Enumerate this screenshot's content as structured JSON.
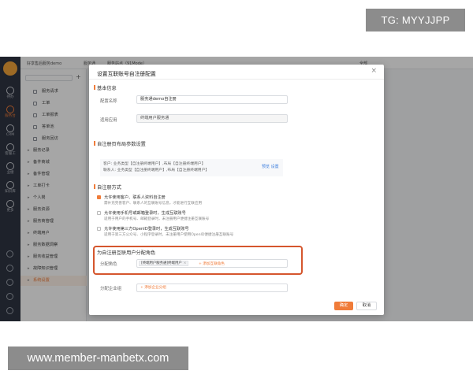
{
  "watermark_top": "TG: MYYJJPP",
  "watermark_bottom": "www.member-manbetx.com",
  "rail": {
    "items": [
      {
        "label": "待办"
      },
      {
        "label": "服务台"
      },
      {
        "label": "CRM"
      },
      {
        "label": "客服工"
      },
      {
        "label": "业绩"
      },
      {
        "label": "知识库"
      },
      {
        "label": "更多"
      }
    ]
  },
  "topbar": {
    "org": "好享售后服务demo",
    "tab1": "服务通",
    "tab2": "服务站点（91Mode）",
    "right": "全部"
  },
  "sidebar": {
    "items": [
      {
        "label": "服务请求",
        "level": "child"
      },
      {
        "label": "工单",
        "level": "child"
      },
      {
        "label": "工单报表",
        "level": "child"
      },
      {
        "label": "答单池",
        "level": "child"
      },
      {
        "label": "服务回访",
        "level": "child"
      },
      {
        "label": "服务记录",
        "level": "top"
      },
      {
        "label": "备件商城",
        "level": "top"
      },
      {
        "label": "备件管理",
        "level": "top"
      },
      {
        "label": "工单打卡",
        "level": "top"
      },
      {
        "label": "个人岗",
        "level": "top"
      },
      {
        "label": "服务资源",
        "level": "top"
      },
      {
        "label": "服务商管理",
        "level": "top"
      },
      {
        "label": "终端用户",
        "level": "top"
      },
      {
        "label": "服务数据洞察",
        "level": "top"
      },
      {
        "label": "服务收益管理",
        "level": "top"
      },
      {
        "label": "故障知识管理",
        "level": "top"
      },
      {
        "label": "系统设置",
        "level": "top",
        "active": true
      }
    ]
  },
  "modal": {
    "title": "设置互联账号自注册配置",
    "basic_section": "基本信息",
    "config_name_label": "配置名称",
    "config_name_value": "服务通demo自注册",
    "app_label": "适用应用",
    "app_value": "终端用户服务通",
    "layout_section": "自注册页布局参数设置",
    "layout_line1": "客户: 业务类型【自注册终端用户】,布局【自注册终端用户】",
    "layout_line2": "联系人: 业务类型【自注册终端用户】,布局【自注册终端用户】",
    "layout_links": "预览 设置",
    "method_section": "自注册方式",
    "methods": [
      {
        "title": "允许使用客户、联系人资料自注册",
        "desc": "需补充完善客户、联系人的互联账号信息，才能进行互联应用",
        "checked": true
      },
      {
        "title": "允许使用手机号或邮箱登录时，生成互联账号",
        "desc": "适用于用户的手机号、邮箱登录时，未注册用户便捷注册互联账号",
        "checked": false
      },
      {
        "title": "允许使用第三方OpenID登录时，生成互联账号",
        "desc": "适用于第三方公众号、小程序登录时，未注册用户使用OpenID便捷注册互联账号",
        "checked": false
      }
    ],
    "role_section": "为自注册互联用户分配角色",
    "role_label": "分配角色",
    "role_tag": "[终端用户服务通]终端用户",
    "role_add": "+ 添加互联角色",
    "company_label": "分配企业组",
    "company_placeholder": "+ 添加企业分组",
    "ok_label": "确定",
    "cancel_label": "取消"
  },
  "colors": {
    "accent": "#f07c3a",
    "highlight_border": "#d5562d",
    "rail_bg": "#2f3542"
  }
}
